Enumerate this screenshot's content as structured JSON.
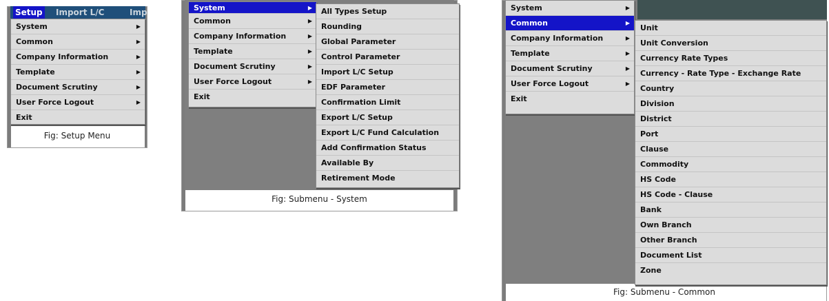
{
  "panel1": {
    "menubar": [
      "Setup",
      "Import L/C",
      "Imp"
    ],
    "items": [
      {
        "label": "System",
        "arrow": "▶"
      },
      {
        "label": "Common",
        "arrow": "▶"
      },
      {
        "label": "Company Information",
        "arrow": "▶"
      },
      {
        "label": "Template",
        "arrow": "▶"
      },
      {
        "label": "Document Scrutiny",
        "arrow": "▶"
      },
      {
        "label": "User Force Logout",
        "arrow": "▶"
      },
      {
        "label": "Exit",
        "arrow": ""
      }
    ],
    "caption": "Fig: Setup Menu"
  },
  "panel2": {
    "items": [
      {
        "label": "System",
        "arrow": "▶"
      },
      {
        "label": "Common",
        "arrow": "▶"
      },
      {
        "label": "Company Information",
        "arrow": "▶"
      },
      {
        "label": "Template",
        "arrow": "▶"
      },
      {
        "label": "Document Scrutiny",
        "arrow": "▶"
      },
      {
        "label": "User Force Logout",
        "arrow": "▶"
      },
      {
        "label": "Exit",
        "arrow": ""
      }
    ],
    "submenu": [
      "All Types Setup",
      "Rounding",
      "Global Parameter",
      "Control Parameter",
      "Import L/C Setup",
      "EDF Parameter",
      "Confirmation Limit",
      "Export L/C Setup",
      "Export L/C Fund Calculation",
      "Add Confirmation Status",
      "Available By",
      "Retirement Mode"
    ],
    "caption": "Fig: Submenu - System"
  },
  "panel3": {
    "items": [
      {
        "label": "System",
        "arrow": "▶"
      },
      {
        "label": "Common",
        "arrow": "▶"
      },
      {
        "label": "Company Information",
        "arrow": "▶"
      },
      {
        "label": "Template",
        "arrow": "▶"
      },
      {
        "label": "Document Scrutiny",
        "arrow": "▶"
      },
      {
        "label": "User Force Logout",
        "arrow": "▶"
      },
      {
        "label": "Exit",
        "arrow": ""
      }
    ],
    "submenu": [
      "Unit",
      "Unit Conversion",
      "Currency Rate Types",
      "Currency - Rate Type - Exchange Rate",
      "Country",
      "Division",
      "District",
      "Port",
      "Clause",
      "Commodity",
      "HS Code",
      "HS Code - Clause",
      "Bank",
      "Own Branch",
      "Other Branch",
      "Document List",
      "Zone"
    ],
    "caption": "Fig: Submenu - Common"
  },
  "colors": {
    "selection": "#1414c8",
    "menu_bg": "#dcdcdc",
    "menubar": "#1f4f7a"
  }
}
